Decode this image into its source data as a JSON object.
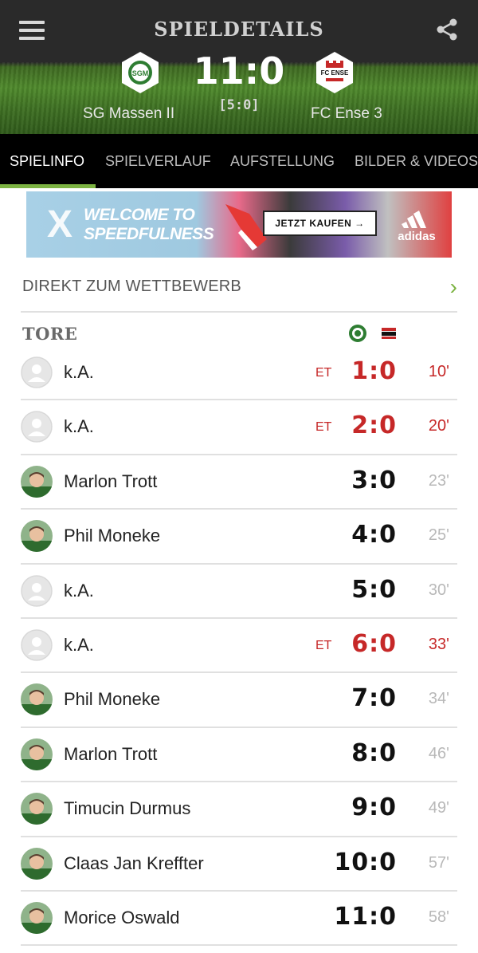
{
  "header": {
    "title": "SPIELDETAILS",
    "score": "11:0",
    "halftime": "[5:0]",
    "home_team": "SG Massen II",
    "away_team": "FC Ense 3",
    "home_logo_text": "SGM",
    "away_logo_text": "FC ENSE",
    "menu_icon": "hamburger-menu-icon",
    "share_icon": "share-icon"
  },
  "tabs": [
    {
      "label": "SPIELINFO",
      "active": true
    },
    {
      "label": "SPIELVERLAUF",
      "active": false
    },
    {
      "label": "AUFSTELLUNG",
      "active": false
    },
    {
      "label": "BILDER & VIDEOS",
      "active": false
    }
  ],
  "ad": {
    "headline": "WELCOME TO SPEEDFULNESS",
    "cta": "JETZT KAUFEN →",
    "brand": "adidas"
  },
  "direct_link": {
    "label": "DIREKT ZUM WETTBEWERB",
    "chevron": "›"
  },
  "goals": {
    "title": "TORE",
    "items": [
      {
        "player": "k.A.",
        "et": "ET",
        "score": "1:0",
        "minute": "10'",
        "own_goal": true,
        "avatar": "placeholder"
      },
      {
        "player": "k.A.",
        "et": "ET",
        "score": "2:0",
        "minute": "20'",
        "own_goal": true,
        "avatar": "placeholder"
      },
      {
        "player": "Marlon Trott",
        "et": "",
        "score": "3:0",
        "minute": "23'",
        "own_goal": false,
        "avatar": "photo"
      },
      {
        "player": "Phil Moneke",
        "et": "",
        "score": "4:0",
        "minute": "25'",
        "own_goal": false,
        "avatar": "photo"
      },
      {
        "player": "k.A.",
        "et": "",
        "score": "5:0",
        "minute": "30'",
        "own_goal": false,
        "avatar": "placeholder"
      },
      {
        "player": "k.A.",
        "et": "ET",
        "score": "6:0",
        "minute": "33'",
        "own_goal": true,
        "avatar": "placeholder"
      },
      {
        "player": "Phil Moneke",
        "et": "",
        "score": "7:0",
        "minute": "34'",
        "own_goal": false,
        "avatar": "photo"
      },
      {
        "player": "Marlon Trott",
        "et": "",
        "score": "8:0",
        "minute": "46'",
        "own_goal": false,
        "avatar": "photo"
      },
      {
        "player": "Timucin Durmus",
        "et": "",
        "score": "9:0",
        "minute": "49'",
        "own_goal": false,
        "avatar": "photo"
      },
      {
        "player": "Claas Jan Kreffter",
        "et": "",
        "score": "10:0",
        "minute": "57'",
        "own_goal": false,
        "avatar": "photo"
      },
      {
        "player": "Morice Oswald",
        "et": "",
        "score": "11:0",
        "minute": "58'",
        "own_goal": false,
        "avatar": "photo"
      }
    ]
  },
  "colors": {
    "accent_green": "#7cb342",
    "own_goal_red": "#c62828",
    "tab_bar": "#000000",
    "header_dark": "#2a2a2a"
  }
}
